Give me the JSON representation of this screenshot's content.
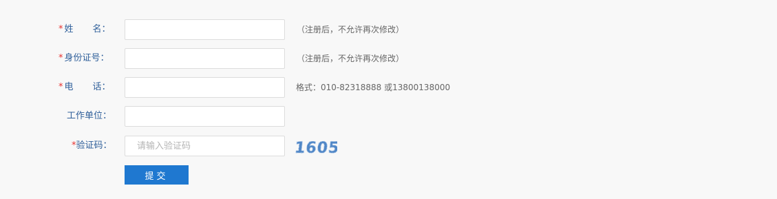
{
  "form": {
    "name": {
      "required_mark": "*",
      "label_part1": "姓",
      "label_part2": "名：",
      "value": "",
      "hint": "（注册后，不允许再次修改）"
    },
    "id_card": {
      "required_mark": "*",
      "label": "身份证号：",
      "value": "",
      "hint": "（注册后，不允许再次修改）"
    },
    "phone": {
      "required_mark": "*",
      "label_part1": "电",
      "label_part2": "话：",
      "value": "",
      "hint": "格式：010-82318888 或13800138000"
    },
    "employer": {
      "label": "工作单位：",
      "value": ""
    },
    "captcha": {
      "required_mark": "*",
      "label": "验证码：",
      "placeholder": "请输入验证码",
      "value": "",
      "image_text": "1605"
    },
    "submit_label": "提交"
  },
  "colors": {
    "background": "#f8f8f8",
    "label": "#2f5f9a",
    "required": "#e8312f",
    "hint": "#666666",
    "button": "#1f78d0",
    "captcha_text": "#4f86c6"
  }
}
